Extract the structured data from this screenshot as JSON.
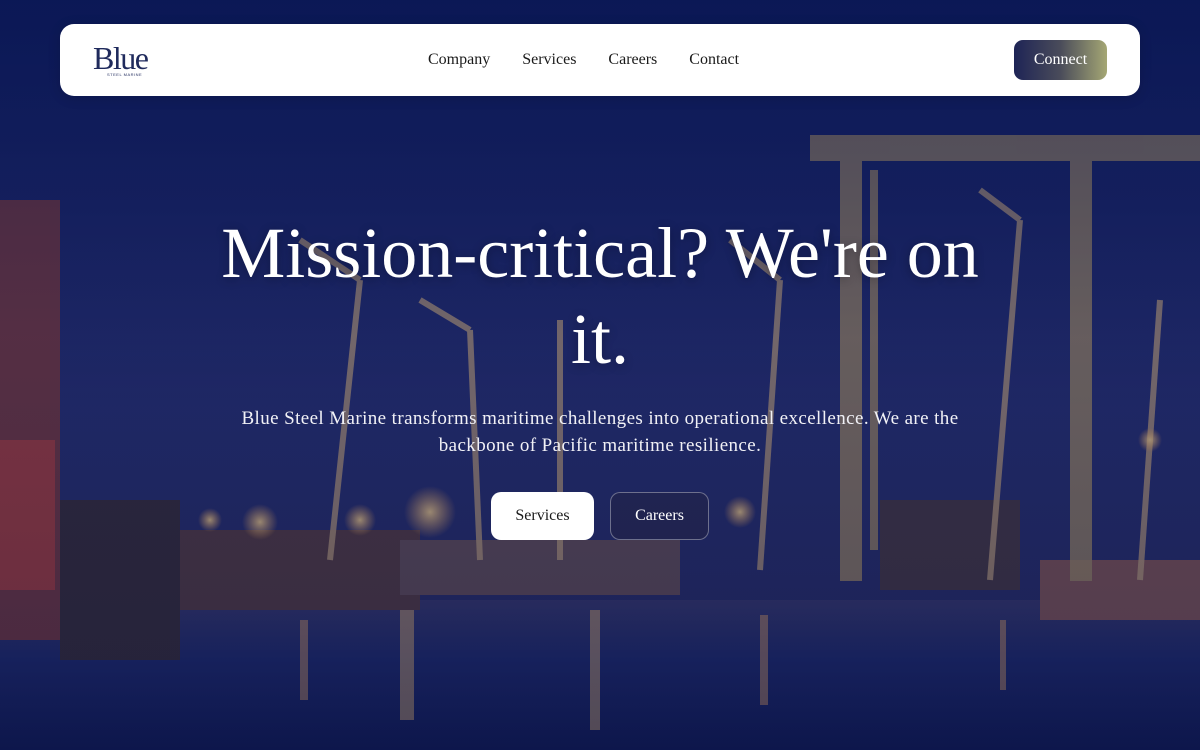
{
  "brand": {
    "logo_text": "Blue",
    "logo_sub": "STEEL MARINE"
  },
  "nav": {
    "links": [
      {
        "label": "Company"
      },
      {
        "label": "Services"
      },
      {
        "label": "Careers"
      },
      {
        "label": "Contact"
      }
    ],
    "connect_label": "Connect"
  },
  "hero": {
    "title": "Mission-critical? We're on it.",
    "subtitle": "Blue Steel Marine transforms maritime challenges into operational excellence. We are the backbone of Pacific maritime resilience.",
    "primary_button": "Services",
    "secondary_button": "Careers"
  },
  "colors": {
    "background_overlay": "#0a1650",
    "nav_bg": "#ffffff",
    "connect_gradient_start": "#1e2456",
    "connect_gradient_end": "#a5a774"
  }
}
